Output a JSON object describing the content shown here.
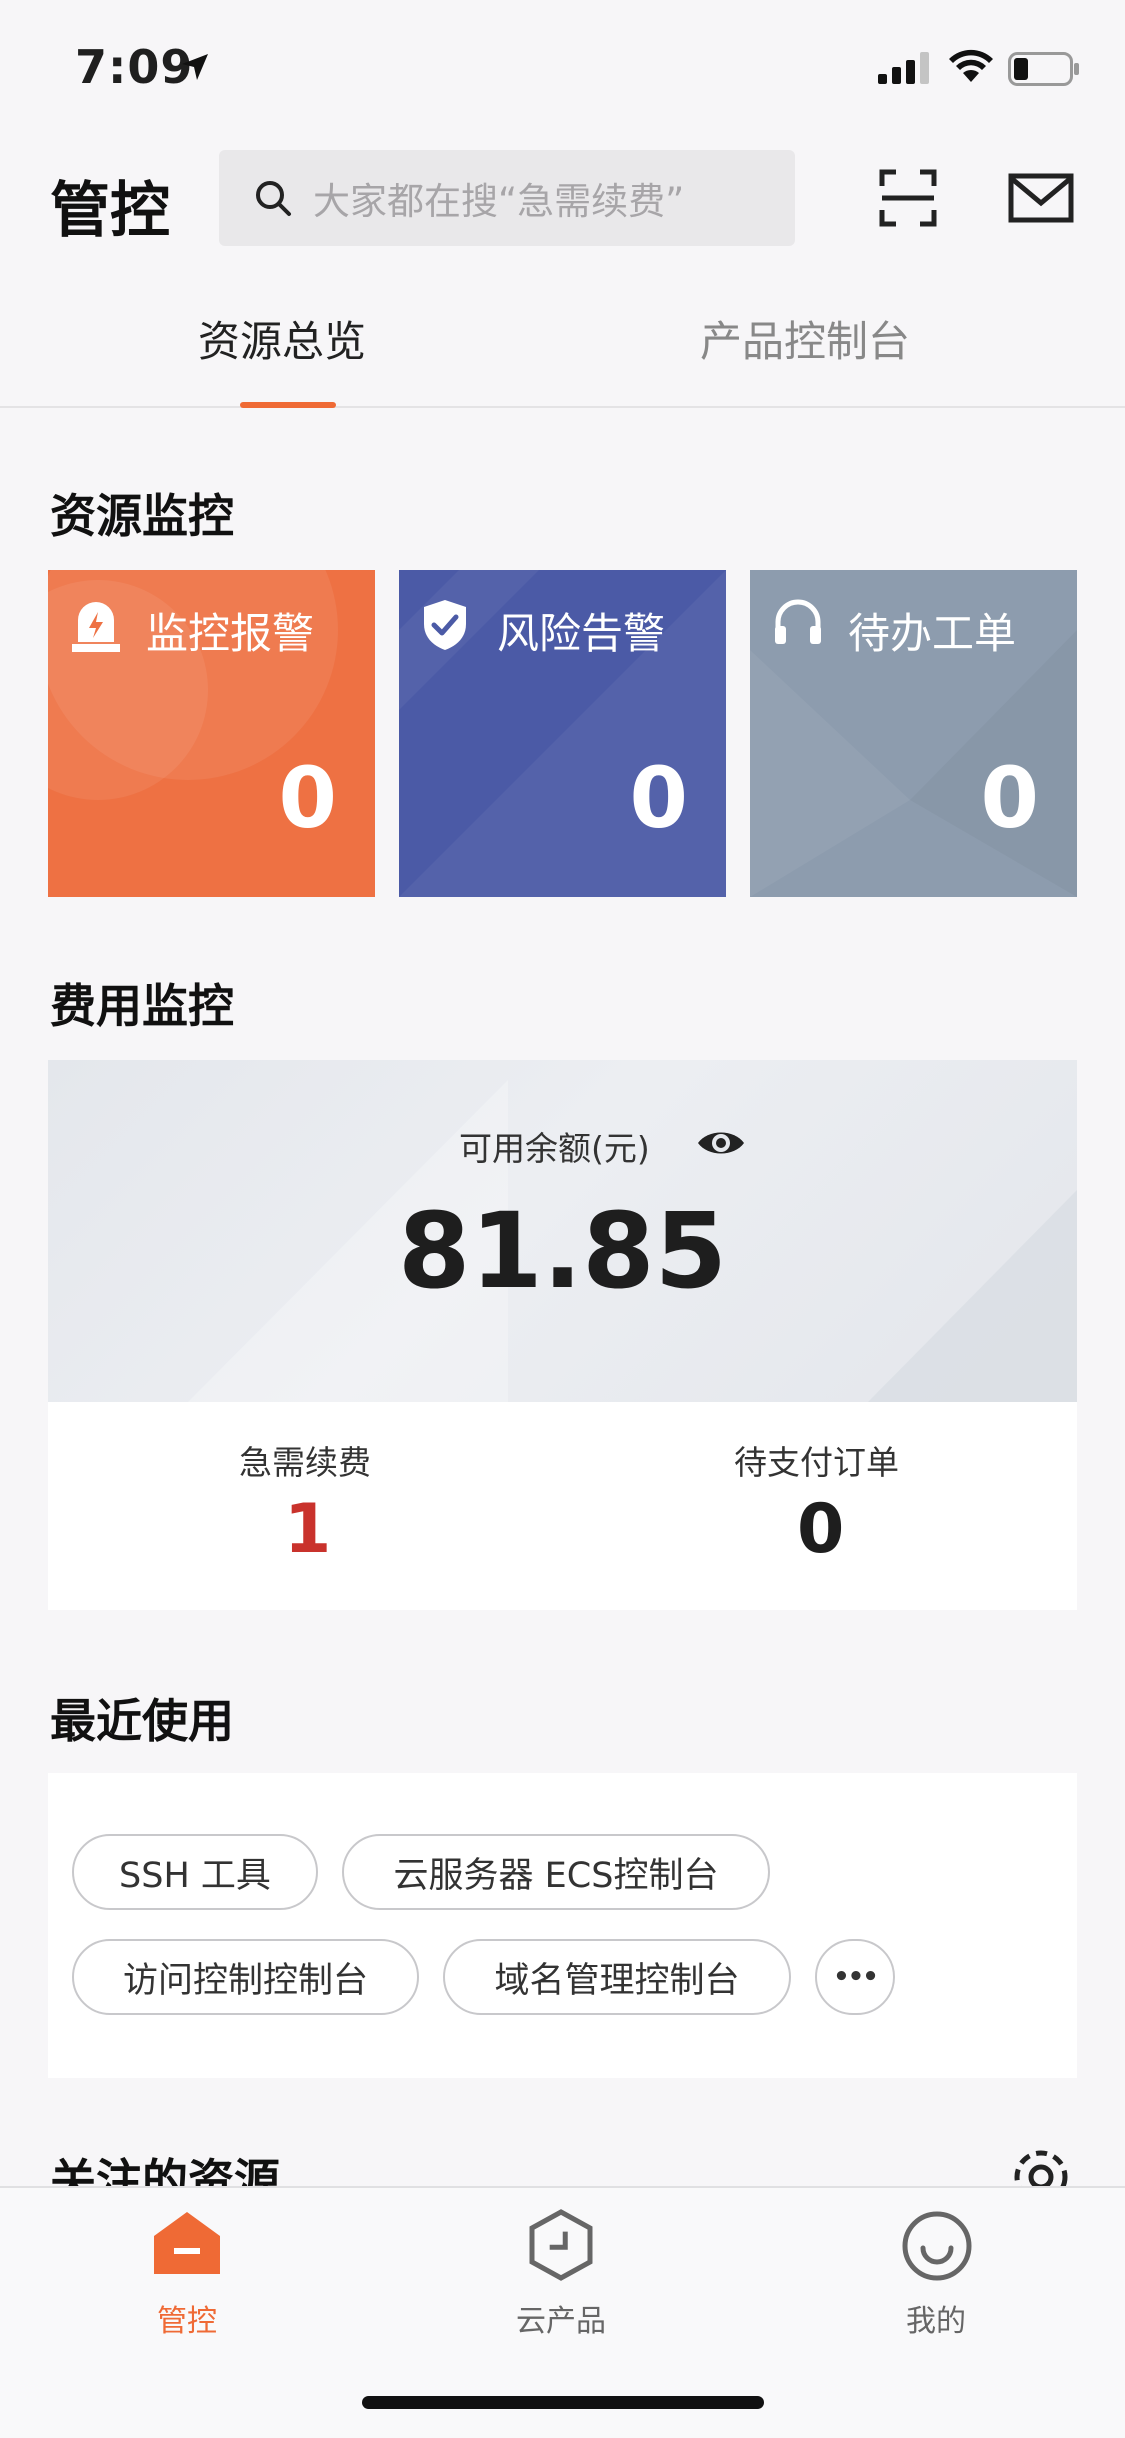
{
  "status_bar": {
    "time": "7:09"
  },
  "header": {
    "title": "管控",
    "search_placeholder": "大家都在搜“急需续费”"
  },
  "tabs": [
    {
      "label": "资源总览",
      "active": true
    },
    {
      "label": "产品控制台",
      "active": false
    }
  ],
  "resource_monitor": {
    "title": "资源监控",
    "cards": [
      {
        "label": "监控报警",
        "value": "0",
        "icon": "alarm-light-icon",
        "color": "#ee7143"
      },
      {
        "label": "风险告警",
        "value": "0",
        "icon": "shield-check-icon",
        "color": "#4b5aa6"
      },
      {
        "label": "待办工单",
        "value": "0",
        "icon": "headset-icon",
        "color": "#8d9cae"
      }
    ]
  },
  "cost_monitor": {
    "title": "费用监控",
    "balance_label": "可用余额(元)",
    "balance_value": "81.85",
    "stats": [
      {
        "label": "急需续费",
        "value": "1",
        "color": "#c9322c"
      },
      {
        "label": "待支付订单",
        "value": "0",
        "color": "#1e1e1e"
      }
    ]
  },
  "recent": {
    "title": "最近使用",
    "chips": [
      "SSH 工具",
      "云服务器 ECS控制台",
      "访问控制控制台",
      "域名管理控制台"
    ],
    "more": "•••"
  },
  "followed": {
    "title": "关注的资源"
  },
  "bottom_nav": [
    {
      "label": "管控",
      "active": true,
      "color": "#ef6a35"
    },
    {
      "label": "云产品",
      "active": false,
      "color": "#666666"
    },
    {
      "label": "我的",
      "active": false,
      "color": "#666666"
    }
  ]
}
